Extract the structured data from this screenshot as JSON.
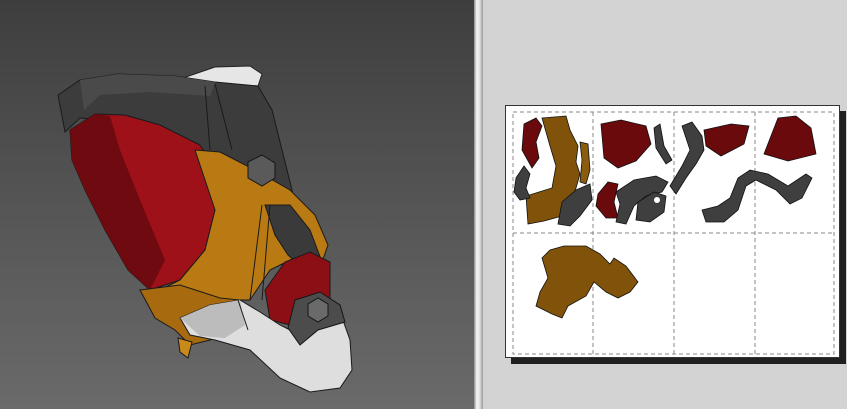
{
  "viewport_3d": {
    "icon": "3d-model-viewport"
  },
  "viewport_2d": {
    "icon": "unfold-pattern-viewport",
    "grid": {
      "columns": 4,
      "rows": 2
    }
  },
  "colors": {
    "maroon": "#6b0a0d",
    "red": "#a8141c",
    "orange": "#b87812",
    "brown": "#80520a",
    "dark_gray": "#3f3f3f",
    "light_gray": "#e2e2e2"
  }
}
